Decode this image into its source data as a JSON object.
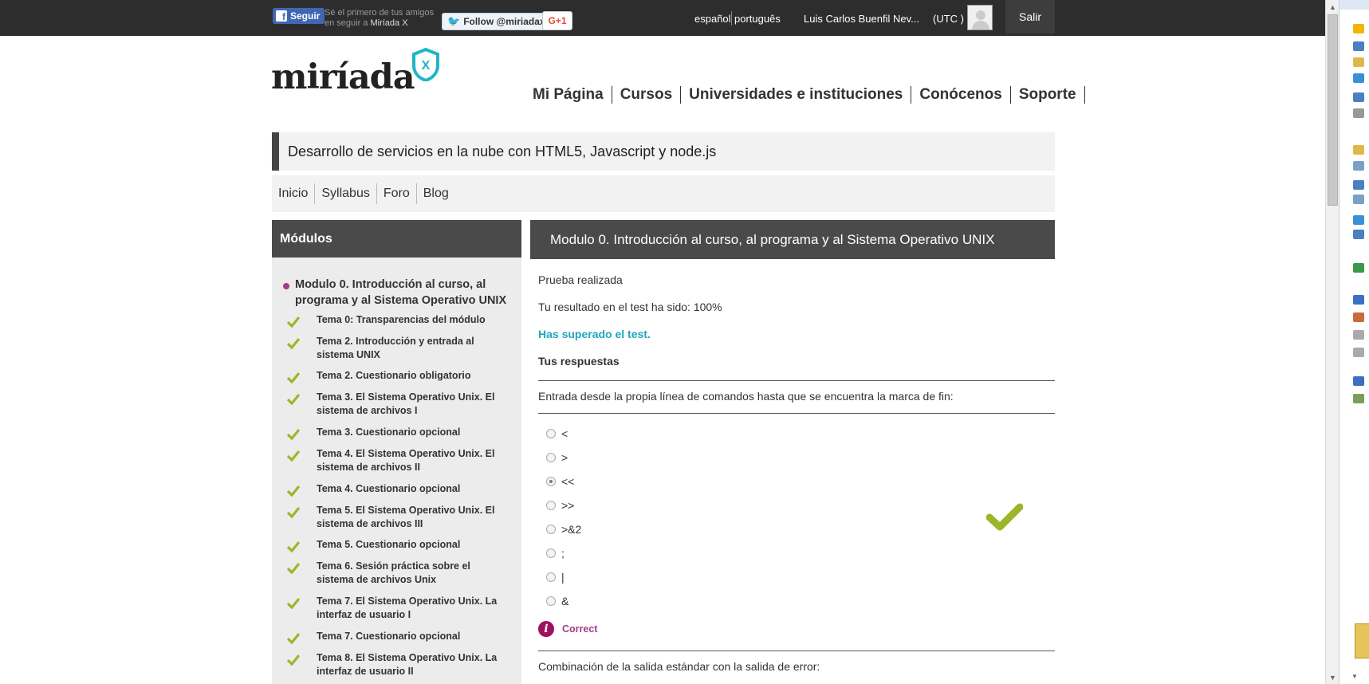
{
  "topbar": {
    "facebook_follow_label": "Seguir",
    "facebook_text_line1": "Sé el primero de tus amigos",
    "facebook_text_line2_prefix": "en seguir a ",
    "facebook_text_line2_brand": "Miríada X",
    "twitter_follow_label": "Follow @miriadax",
    "gplus_label": "G+1",
    "languages": [
      "español",
      "português"
    ],
    "user_name": "Luis Carlos Buenfil Nev...",
    "timezone": "(UTC )",
    "logout_label": "Salir"
  },
  "logo": {
    "text": "miríada",
    "badge": "X"
  },
  "main_nav": [
    "Mi Página",
    "Cursos",
    "Universidades e instituciones",
    "Conócenos",
    "Soporte"
  ],
  "course": {
    "title": "Desarrollo de servicios en la nube con HTML5, Javascript y node.js",
    "subnav": [
      "Inicio",
      "Syllabus",
      "Foro",
      "Blog"
    ]
  },
  "sidebar": {
    "heading": "Módulos",
    "module_title": "Modulo 0. Introducción al curso, al programa y al Sistema Operativo UNIX",
    "topics": [
      "Tema 0: Transparencias del módulo",
      "Tema 2. Introducción y entrada al sistema UNIX",
      "Tema 2. Cuestionario obligatorio",
      "Tema 3. El Sistema Operativo Unix. El sistema de archivos I",
      "Tema 3. Cuestionario opcional",
      "Tema 4. El Sistema Operativo Unix. El sistema de archivos II",
      "Tema 4. Cuestionario opcional",
      "Tema 5. El Sistema Operativo Unix. El sistema de archivos III",
      "Tema 5. Cuestionario opcional",
      "Tema 6. Sesión práctica sobre el sistema de archivos Unix",
      "Tema 7. El Sistema Operativo Unix. La interfaz de usuario I",
      "Tema 7. Cuestionario opcional",
      "Tema 8. El Sistema Operativo Unix. La interfaz de usuario II"
    ]
  },
  "content": {
    "heading": "Modulo 0. Introducción al curso, al programa y al Sistema Operativo UNIX",
    "status": "Prueba realizada",
    "result": "Tu resultado en el test ha sido: 100%",
    "passed": "Has superado el test.",
    "answers_heading": "Tus respuestas",
    "question1": "Entrada desde la propia línea de comandos hasta que se encuentra la marca de fin:",
    "options": [
      "<",
      ">",
      "<<",
      ">>",
      ">&2",
      ";",
      "|",
      "&"
    ],
    "selected_option": "<<",
    "feedback": "Correct",
    "question2": "Combinación de la salida estándar con la salida de error:"
  },
  "colors": {
    "topbar_bg": "#2d2d2d",
    "panel_header_bg": "#4a4a4a",
    "check_green": "#9cb62a",
    "pass_teal": "#1fa7bf",
    "feedback_purple": "#a33d88",
    "logo_teal": "#1fb5c4"
  }
}
